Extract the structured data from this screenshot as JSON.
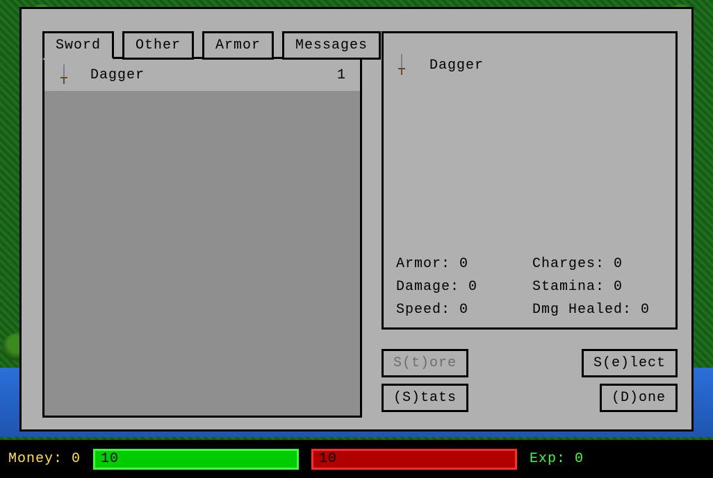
{
  "tabs": {
    "sword": "Sword",
    "other": "Other",
    "armor": "Armor",
    "messages": "Messages",
    "active": "sword"
  },
  "inventory": {
    "items": [
      {
        "name": "Dagger",
        "qty": "1"
      }
    ]
  },
  "detail": {
    "name": "Dagger",
    "stats": {
      "armor_label": "Armor: 0",
      "charges_label": "Charges: 0",
      "damage_label": "Damage: 0",
      "stamina_label": "Stamina: 0",
      "speed_label": "Speed: 0",
      "dmg_healed_label": "Dmg Healed: 0"
    }
  },
  "buttons": {
    "store": "S(t)ore",
    "select": "S(e)lect",
    "stats": "(S)tats",
    "done": "(D)one"
  },
  "status": {
    "money_label": "Money: 0",
    "hp_value": "10",
    "mp_value": "10",
    "exp_label": "Exp: 0"
  }
}
